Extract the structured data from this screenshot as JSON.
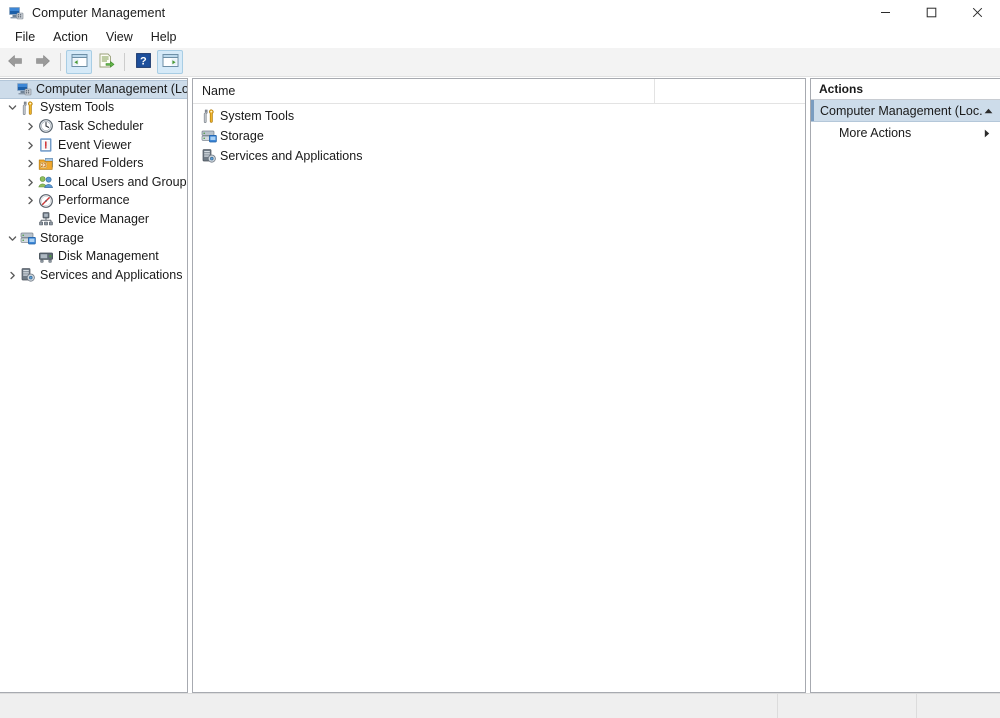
{
  "window": {
    "title": "Computer Management",
    "icon": "computer-management-icon",
    "controls": {
      "minimize": "minimize-icon",
      "maximize": "maximize-icon",
      "close": "close-icon"
    }
  },
  "menubar": {
    "items": [
      {
        "label": "File",
        "name": "menu-file"
      },
      {
        "label": "Action",
        "name": "menu-action"
      },
      {
        "label": "View",
        "name": "menu-view"
      },
      {
        "label": "Help",
        "name": "menu-help"
      }
    ]
  },
  "toolbar": {
    "buttons": [
      {
        "name": "back-button",
        "icon": "back-arrow-icon"
      },
      {
        "name": "forward-button",
        "icon": "forward-arrow-icon"
      },
      {
        "name": "show-hide-tree-button",
        "icon": "console-tree-icon"
      },
      {
        "name": "export-list-button",
        "icon": "export-list-icon"
      },
      {
        "name": "help-button",
        "icon": "help-question-icon"
      },
      {
        "name": "show-hide-action-pane-button",
        "icon": "action-pane-icon"
      }
    ]
  },
  "tree": {
    "items": [
      {
        "label": "Computer Management (Local)",
        "icon": "computer-icon",
        "indent": 0,
        "twisty": "none",
        "selected": true
      },
      {
        "label": "System Tools",
        "icon": "system-tools-icon",
        "indent": 1,
        "twisty": "expanded",
        "selected": false
      },
      {
        "label": "Task Scheduler",
        "icon": "task-scheduler-icon",
        "indent": 2,
        "twisty": "collapsed",
        "selected": false
      },
      {
        "label": "Event Viewer",
        "icon": "event-viewer-icon",
        "indent": 2,
        "twisty": "collapsed",
        "selected": false
      },
      {
        "label": "Shared Folders",
        "icon": "shared-folders-icon",
        "indent": 2,
        "twisty": "collapsed",
        "selected": false
      },
      {
        "label": "Local Users and Groups",
        "icon": "local-users-icon",
        "indent": 2,
        "twisty": "collapsed",
        "selected": false
      },
      {
        "label": "Performance",
        "icon": "performance-icon",
        "indent": 2,
        "twisty": "collapsed",
        "selected": false
      },
      {
        "label": "Device Manager",
        "icon": "device-manager-icon",
        "indent": 2,
        "twisty": "none",
        "selected": false
      },
      {
        "label": "Storage",
        "icon": "storage-icon",
        "indent": 1,
        "twisty": "expanded",
        "selected": false
      },
      {
        "label": "Disk Management",
        "icon": "disk-management-icon",
        "indent": 2,
        "twisty": "none",
        "selected": false
      },
      {
        "label": "Services and Applications",
        "icon": "services-icon",
        "indent": 1,
        "twisty": "collapsed",
        "selected": false
      }
    ]
  },
  "list": {
    "columns": [
      "Name"
    ],
    "rows": [
      {
        "name": "System Tools",
        "icon": "system-tools-icon"
      },
      {
        "name": "Storage",
        "icon": "storage-icon"
      },
      {
        "name": "Services and Applications",
        "icon": "services-icon"
      }
    ]
  },
  "actions": {
    "header": "Actions",
    "band": {
      "label": "Computer Management (Loc...",
      "chevron": "chevron-up-icon"
    },
    "items": [
      {
        "label": "More Actions",
        "arrow": "submenu-arrow-icon"
      }
    ]
  },
  "statusbar": {
    "segments": [
      "",
      "",
      ""
    ]
  },
  "colors": {
    "selection": "#cddcea",
    "selection_border": "#b4c7d9",
    "selection_accent": "#7a9cc0",
    "pane_border": "#a7aab0",
    "toolbar_bg": "#f3f3f3",
    "statusbar_bg": "#efefef"
  }
}
